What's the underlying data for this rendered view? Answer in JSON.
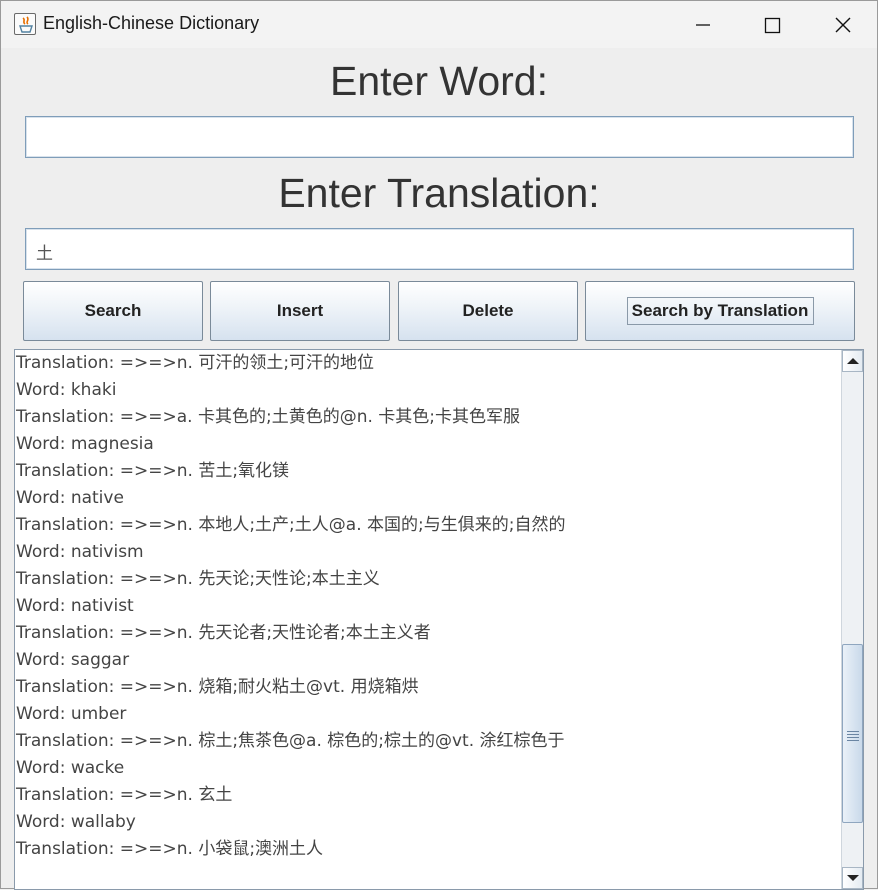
{
  "window": {
    "title": "English-Chinese Dictionary"
  },
  "controls": {
    "minimize": "minimize-icon",
    "maximize": "maximize-icon",
    "close": "close-icon"
  },
  "form": {
    "word_heading": "Enter Word:",
    "word_value": "",
    "translation_heading": "Enter Translation:",
    "translation_value": "土"
  },
  "buttons": {
    "search": "Search",
    "insert": "Insert",
    "delete": "Delete",
    "search_by_translation": "Search by Translation"
  },
  "results": {
    "lines": [
      "Translation: =>=>n. 可汗的领土;可汗的地位",
      "Word: khaki",
      "Translation: =>=>a. 卡其色的;土黄色的@n. 卡其色;卡其色军服",
      "Word: magnesia",
      "Translation: =>=>n. 苦土;氧化镁",
      "Word: native",
      "Translation: =>=>n. 本地人;土产;土人@a. 本国的;与生俱来的;自然的",
      "Word: nativism",
      "Translation: =>=>n. 先天论;天性论;本土主义",
      "Word: nativist",
      "Translation: =>=>n. 先天论者;天性论者;本土主义者",
      "Word: saggar",
      "Translation: =>=>n. 烧箱;耐火粘土@vt. 用烧箱烘",
      "Word: umber",
      "Translation: =>=>n. 棕土;焦茶色@a. 棕色的;棕土的@vt. 涂红棕色于",
      "Word: wacke",
      "Translation: =>=>n. 玄土",
      "Word: wallaby",
      "Translation: =>=>n. 小袋鼠;澳洲土人"
    ],
    "scroll_position": 0.86
  }
}
